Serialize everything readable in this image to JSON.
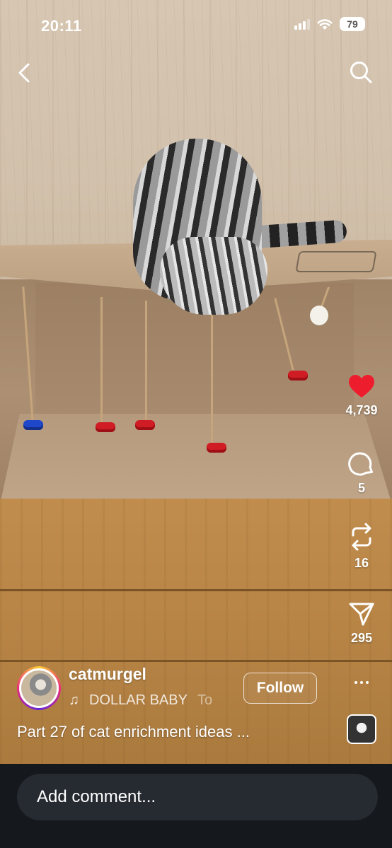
{
  "status_bar": {
    "time": "20:11",
    "battery": "79"
  },
  "author": {
    "username": "catmurgel",
    "follow_label": "Follow"
  },
  "audio": {
    "note_icon": "♫",
    "title": "DOLLAR BABY",
    "next": "To"
  },
  "caption": "Part 27 of cat enrichment ideas ...",
  "actions": {
    "likes": "4,739",
    "comments": "5",
    "reposts": "16",
    "shares": "295"
  },
  "comment_bar": {
    "placeholder": "Add comment..."
  },
  "icons": {
    "back": "chevron-left-icon",
    "search": "search-icon",
    "like": "heart-icon",
    "comment": "comment-bubble-icon",
    "repost": "repost-icon",
    "share": "paper-plane-icon",
    "more": "ellipsis-icon"
  },
  "colors": {
    "like_active": "#ee1d2e",
    "comment_bar_bg": "#15181d",
    "input_bg": "#262a31"
  }
}
